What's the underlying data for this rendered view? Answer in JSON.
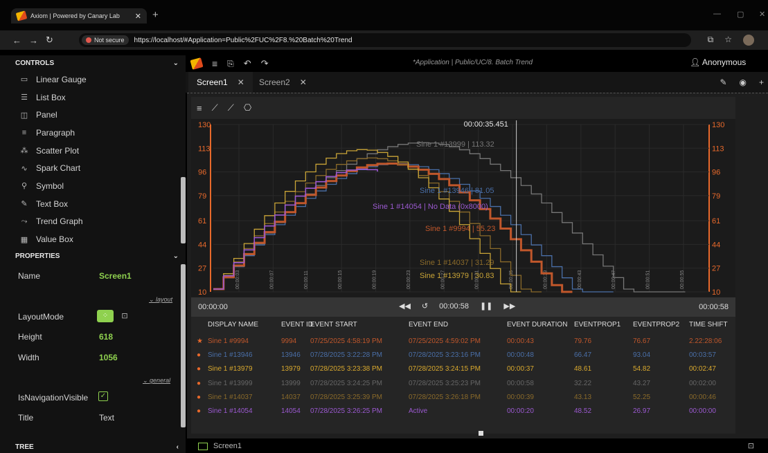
{
  "browser": {
    "tab_title": "Axiom | Powered by Canary Lab",
    "not_secure": "Not secure",
    "url": "https://localhost/#Application=Public%2FUC%2F8.%20Batch%20Trend"
  },
  "controls": {
    "title": "CONTROLS",
    "items": [
      {
        "label": "Linear Gauge",
        "icon": "linear-gauge-icon"
      },
      {
        "label": "List Box",
        "icon": "list-box-icon"
      },
      {
        "label": "Panel",
        "icon": "panel-icon"
      },
      {
        "label": "Paragraph",
        "icon": "paragraph-icon"
      },
      {
        "label": "Scatter Plot",
        "icon": "scatter-plot-icon"
      },
      {
        "label": "Spark Chart",
        "icon": "spark-chart-icon"
      },
      {
        "label": "Symbol",
        "icon": "symbol-icon"
      },
      {
        "label": "Text Box",
        "icon": "text-box-icon"
      },
      {
        "label": "Trend Graph",
        "icon": "trend-graph-icon"
      },
      {
        "label": "Value Box",
        "icon": "value-box-icon"
      }
    ]
  },
  "properties": {
    "title": "PROPERTIES",
    "name_label": "Name",
    "name_value": "Screen1",
    "group_layout": "layout",
    "layoutmode_label": "LayoutMode",
    "height_label": "Height",
    "height_value": "618",
    "width_label": "Width",
    "width_value": "1056",
    "group_general": "general",
    "isnav_label": "IsNavigationVisible",
    "title_label": "Title",
    "title_value": "Text"
  },
  "tree": {
    "title": "TREE"
  },
  "app": {
    "title": "*Application | Public/UC/8. Batch Trend",
    "user": "Anonymous",
    "tabs": [
      "Screen1",
      "Screen2"
    ],
    "bottom_tab": "Screen1"
  },
  "trend": {
    "cursor_time": "00:00:35.451",
    "start_time": "00:00:00",
    "play_time": "00:00:58",
    "end_time": "00:00:58",
    "y_ticks": [
      "130",
      "113",
      "96",
      "79",
      "61",
      "44",
      "27",
      "10"
    ],
    "x_ticks": [
      "00:00:03",
      "00:00:07",
      "00:00:11",
      "00:00:15",
      "00:00:19",
      "00:00:23",
      "00:00:27",
      "00:00:31",
      "00:00:35",
      "00:00:39",
      "00:00:43",
      "00:00:47",
      "00:00:51",
      "00:00:55"
    ],
    "labels": [
      {
        "text": "Sine 1 #13999 | 113.32",
        "color": "#777777"
      },
      {
        "text": "Sine 1 #13946 | 81.05",
        "color": "#4a6fa8"
      },
      {
        "text": "Sine 1 #14054 | No Data (0x8000)",
        "color": "#9b59d0"
      },
      {
        "text": "Sine 1 #9994 | 55.23",
        "color": "#c0572b"
      },
      {
        "text": "Sine 1 #14037 | 31.29",
        "color": "#8a6a2a"
      },
      {
        "text": "Sine 1 #13979 | 30.83",
        "color": "#c9a437"
      }
    ]
  },
  "grid": {
    "headers": [
      "DISPLAY NAME",
      "EVENT ID",
      "EVENT START",
      "EVENT END",
      "EVENT DURATION",
      "EVENTPROP1",
      "EVENTPROP2",
      "TIME SHIFT"
    ],
    "rows": [
      {
        "marker": "★",
        "color": "#c0572b",
        "cells": [
          "Sine 1 #9994",
          "9994",
          "07/25/2025 4:58:19 PM",
          "07/25/2025 4:59:02 PM",
          "00:00:43",
          "79.76",
          "76.67",
          "2.22:28:06"
        ]
      },
      {
        "marker": "●",
        "color": "#4a6fa8",
        "cells": [
          "Sine 1 #13946",
          "13946",
          "07/28/2025 3:22:28 PM",
          "07/28/2025 3:23:16 PM",
          "00:00:48",
          "66.47",
          "93.04",
          "00:03:57"
        ]
      },
      {
        "marker": "●",
        "color": "#d9a92e",
        "cells": [
          "Sine 1 #13979",
          "13979",
          "07/28/2025 3:23:38 PM",
          "07/28/2025 3:24:15 PM",
          "00:00:37",
          "48.61",
          "54.82",
          "00:02:47"
        ]
      },
      {
        "marker": "●",
        "color": "#666666",
        "cells": [
          "Sine 1 #13999",
          "13999",
          "07/28/2025 3:24:25 PM",
          "07/28/2025 3:25:23 PM",
          "00:00:58",
          "32.22",
          "43.27",
          "00:02:00"
        ]
      },
      {
        "marker": "●",
        "color": "#8a6a2a",
        "cells": [
          "Sine 1 #14037",
          "14037",
          "07/28/2025 3:25:39 PM",
          "07/28/2025 3:26:18 PM",
          "00:00:39",
          "43.13",
          "52.25",
          "00:00:46"
        ]
      },
      {
        "marker": "●",
        "color": "#9b59d0",
        "cells": [
          "Sine 1 #14054",
          "14054",
          "07/28/2025 3:26:25 PM",
          "Active",
          "00:00:20",
          "48.52",
          "26.97",
          "00:00:00"
        ]
      }
    ]
  },
  "colors": {
    "accent": "#e8692b",
    "green": "#8fd14f"
  }
}
